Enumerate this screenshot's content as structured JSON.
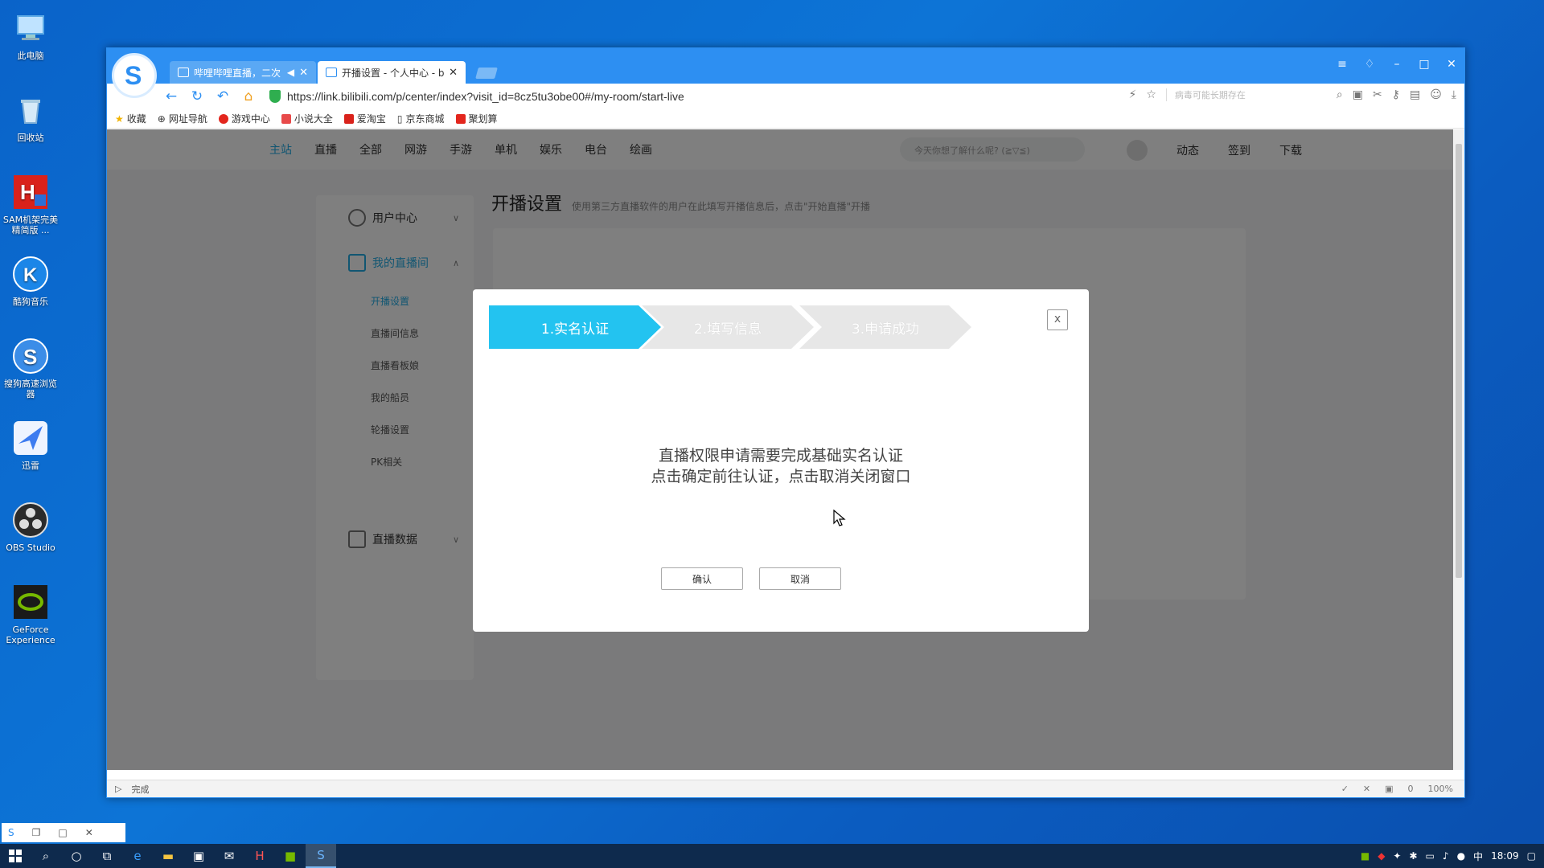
{
  "desktop": {
    "icons": [
      {
        "label": "此电脑",
        "icon": "computer-icon"
      },
      {
        "label": "回收站",
        "icon": "recycle-bin-icon"
      },
      {
        "label": "SAM机架完美精简版 ...",
        "icon": "sam-rack-icon"
      },
      {
        "label": "酷狗音乐",
        "icon": "kugou-music-icon"
      },
      {
        "label": "搜狗高速浏览器",
        "icon": "sogou-browser-icon"
      },
      {
        "label": "迅雷",
        "icon": "xunlei-icon"
      },
      {
        "label": "OBS Studio",
        "icon": "obs-icon"
      },
      {
        "label": "GeForce Experience",
        "icon": "geforce-icon"
      }
    ]
  },
  "browser": {
    "tabs": [
      {
        "title": "哔哩哔哩直播，二次",
        "active": false
      },
      {
        "title": "开播设置 - 个人中心 - b",
        "active": true
      }
    ],
    "url": "https://link.bilibili.com/p/center/index?visit_id=8cz5tu3obe00#/my-room/start-live",
    "search_placeholder": "病毒可能长期存在",
    "bookmarks": [
      "收藏",
      "网址导航",
      "游戏中心",
      "小说大全",
      "爱淘宝",
      "京东商城",
      "聚划算"
    ],
    "status_text": "完成",
    "status_right": {
      "count": "0",
      "zoom": "100%"
    }
  },
  "site": {
    "nav": [
      "主站",
      "直播",
      "全部",
      "网游",
      "手游",
      "单机",
      "娱乐",
      "电台",
      "绘画"
    ],
    "search_placeholder": "今天你想了解什么呢? (≧▽≦)",
    "right_links": [
      "动态",
      "签到",
      "下载"
    ],
    "sidebar": {
      "user_center": "用户中心",
      "my_room": "我的直播间",
      "sub_items": [
        "开播设置",
        "直播间信息",
        "直播看板娘",
        "我的船员",
        "轮播设置",
        "PK相关"
      ],
      "live_data": "直播数据"
    },
    "page_title": "开播设置",
    "page_subtitle": "使用第三方直播软件的用户在此填写开播信息后，点击\"开始直播\"开播"
  },
  "modal": {
    "steps": [
      "1.实名认证",
      "2.填写信息",
      "3.申请成功"
    ],
    "close": "x",
    "message_line1": "直播权限申请需要完成基础实名认证",
    "message_line2": "点击确定前往认证，点击取消关闭窗口",
    "confirm": "确认",
    "cancel": "取消"
  },
  "taskbar": {
    "time": "18:09",
    "ime": "中"
  },
  "colors": {
    "accent": "#23c3f0",
    "browser_blue": "#2d8ff2",
    "step_inactive": "#e7e7e7"
  }
}
